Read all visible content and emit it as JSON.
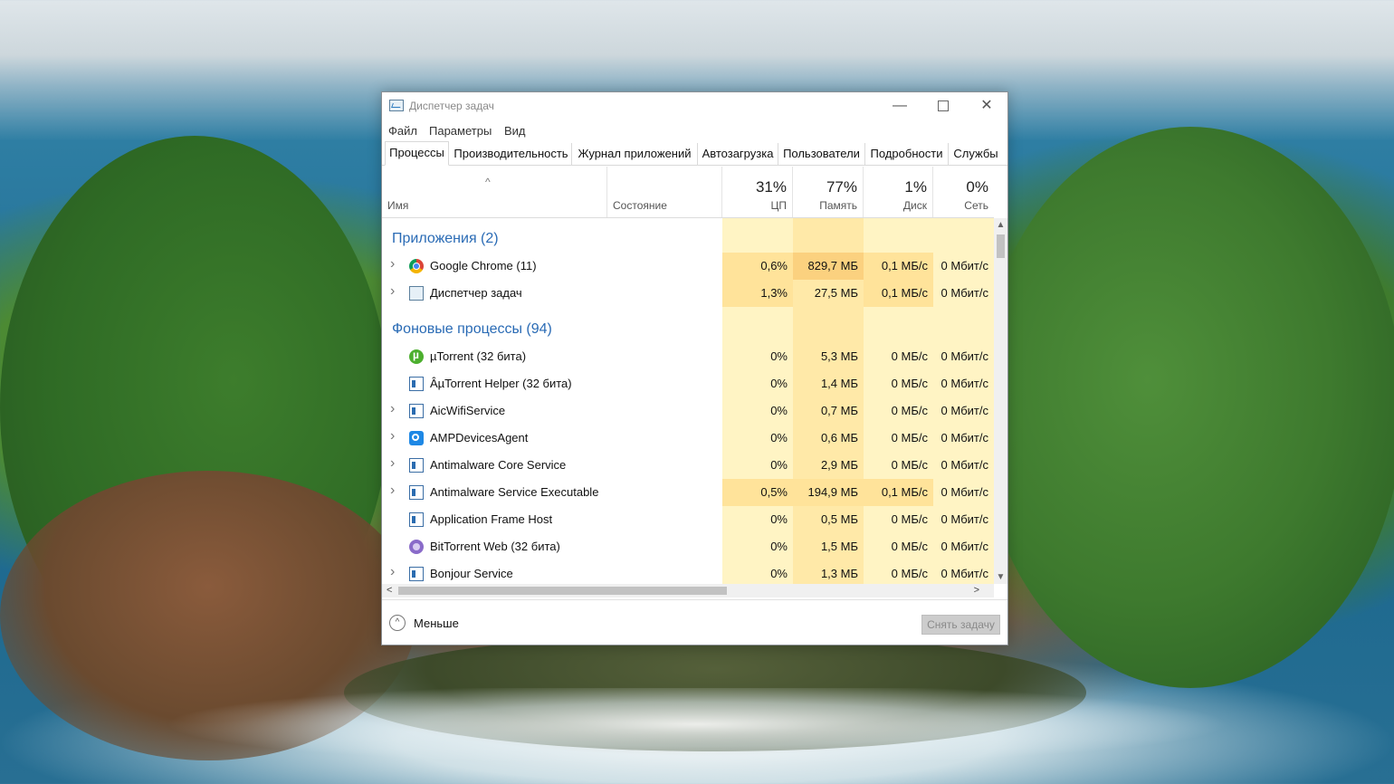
{
  "window": {
    "title": "Диспетчер задач",
    "min_glyph": "—",
    "close_glyph": "✕"
  },
  "menu": [
    "Файл",
    "Параметры",
    "Вид"
  ],
  "tabs": [
    "Процессы",
    "Производительность",
    "Журнал приложений",
    "Автозагрузка",
    "Пользователи",
    "Подробности",
    "Службы"
  ],
  "active_tab": "Процессы",
  "columns": {
    "name": "Имя",
    "status": "Состояние",
    "sort_glyph": "^",
    "cpu": {
      "pct": "31%",
      "label": "ЦП"
    },
    "mem": {
      "pct": "77%",
      "label": "Память"
    },
    "disk": {
      "pct": "1%",
      "label": "Диск"
    },
    "net": {
      "pct": "0%",
      "label": "Сеть"
    }
  },
  "groups": {
    "apps": "Приложения (2)",
    "background": "Фоновые процессы (94)"
  },
  "processes": [
    {
      "name": "Google Chrome (11)",
      "icon": "chrome-icon",
      "expand": true,
      "cpu": "0,6%",
      "mem": "829,7 МБ",
      "disk": "0,1 МБ/с",
      "net": "0 Мбит/с"
    },
    {
      "name": "Диспетчер задач",
      "icon": "task-manager-icon",
      "expand": true,
      "cpu": "1,3%",
      "mem": "27,5 МБ",
      "disk": "0,1 МБ/с",
      "net": "0 Мбит/с"
    },
    {
      "name": "µTorrent (32 бита)",
      "icon": "utorrent-icon",
      "expand": false,
      "cpu": "0%",
      "mem": "5,3 МБ",
      "disk": "0 МБ/с",
      "net": "0 Мбит/с"
    },
    {
      "name": "ÂµTorrent Helper (32 бита)",
      "icon": "service-icon",
      "expand": false,
      "cpu": "0%",
      "mem": "1,4 МБ",
      "disk": "0 МБ/с",
      "net": "0 Мбит/с"
    },
    {
      "name": "AicWifiService",
      "icon": "service-icon",
      "expand": true,
      "cpu": "0%",
      "mem": "0,7 МБ",
      "disk": "0 МБ/с",
      "net": "0 Мбит/с"
    },
    {
      "name": "AMPDevicesAgent",
      "icon": "amp-icon",
      "expand": true,
      "cpu": "0%",
      "mem": "0,6 МБ",
      "disk": "0 МБ/с",
      "net": "0 Мбит/с"
    },
    {
      "name": "Antimalware Core Service",
      "icon": "service-icon",
      "expand": true,
      "cpu": "0%",
      "mem": "2,9 МБ",
      "disk": "0 МБ/с",
      "net": "0 Мбит/с"
    },
    {
      "name": "Antimalware Service Executable",
      "icon": "service-icon",
      "expand": true,
      "cpu": "0,5%",
      "mem": "194,9 МБ",
      "disk": "0,1 МБ/с",
      "net": "0 Мбит/с"
    },
    {
      "name": "Application Frame Host",
      "icon": "service-icon",
      "expand": false,
      "cpu": "0%",
      "mem": "0,5 МБ",
      "disk": "0 МБ/с",
      "net": "0 Мбит/с"
    },
    {
      "name": "BitTorrent Web (32 бита)",
      "icon": "bittorrent-icon",
      "expand": false,
      "cpu": "0%",
      "mem": "1,5 МБ",
      "disk": "0 МБ/с",
      "net": "0 Мбит/с"
    },
    {
      "name": "Bonjour Service",
      "icon": "service-icon",
      "expand": true,
      "cpu": "0%",
      "mem": "1,3 МБ",
      "disk": "0 МБ/с",
      "net": "0 Мбит/с"
    }
  ],
  "footer": {
    "less_label": "Меньше",
    "less_glyph": "^",
    "end_task_label": "Снять задачу"
  },
  "scroll": {
    "up": "▲",
    "down": "▼",
    "left": "<",
    "right": ">"
  },
  "colors": {
    "cpu_bg": "#fff4c4",
    "mem_bg": "#ffe9a8",
    "mem_hot": "#fbd17f",
    "disk_bg": "#fff4c4",
    "net_bg": "#fff4c4",
    "light_bg": "#fff9e0",
    "group_title": "#2a6bb5",
    "highlight": "#ffe39a"
  }
}
